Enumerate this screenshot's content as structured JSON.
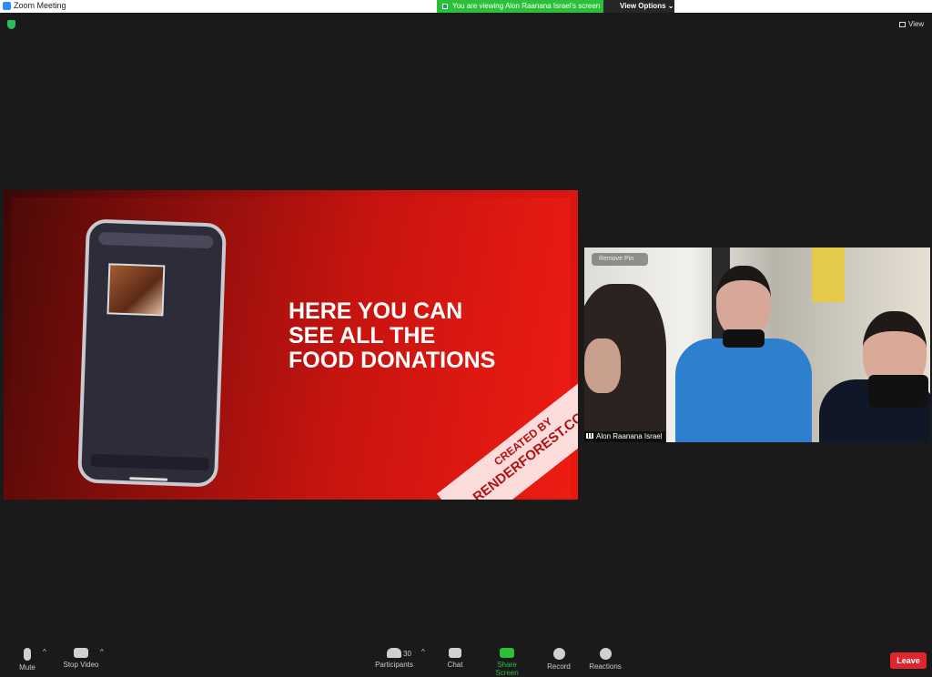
{
  "window": {
    "title": "Zoom Meeting"
  },
  "banner": {
    "viewing": "You are viewing Alon Raanana Israel's screen",
    "options": "View Options ⌄"
  },
  "view_button": "View",
  "slide": {
    "line1": "HERE YOU CAN",
    "line2": "SEE ALL THE",
    "line3": "FOOD DONATIONS",
    "ribbon_top": "CREATED BY",
    "ribbon_bottom": "RENDERFOREST.COM"
  },
  "video": {
    "remove_pin": "Remove Pin",
    "name": "Alon Raanana Israel"
  },
  "toolbar": {
    "mute": "Mute",
    "stop_video": "Stop Video",
    "participants": "Participants",
    "participants_count": "30",
    "chat": "Chat",
    "share_screen": "Share Screen",
    "record": "Record",
    "reactions": "Reactions",
    "leave": "Leave"
  },
  "colors": {
    "share_green": "#2cbf3a",
    "leave_red": "#e0262d",
    "slide_red": "#c81410"
  }
}
